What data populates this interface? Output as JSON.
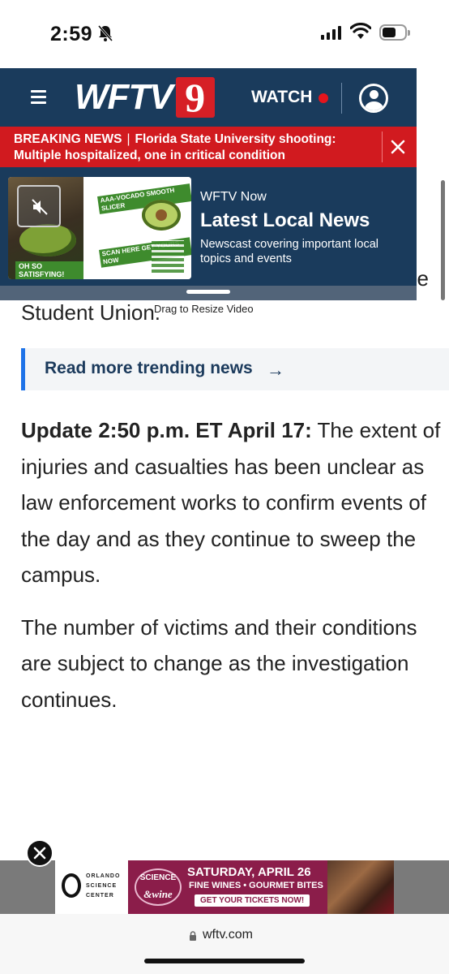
{
  "status_bar": {
    "time": "2:59"
  },
  "header": {
    "logo_text": "WFTV",
    "logo_number": "9",
    "watch_label": "WATCH"
  },
  "breaking": {
    "label": "BREAKING NEWS",
    "separator": "|",
    "headline": "Florida State University shooting: Multiple hospitalized, one in critical condition"
  },
  "video": {
    "ad_tag": "OH SO SATISFYING!",
    "ad_brand": "AAA-VOCADO SMOOTH SLICER",
    "ad_scan": "SCAN HERE GET YOURS NOW",
    "source": "WFTV Now",
    "title": "Latest Local News",
    "description": "Newscast covering important local topics and events",
    "resize_label": "Drag to Resize Video"
  },
  "article": {
    "partial_line_end": "he",
    "partial_line": "Student Union.",
    "trending_label": "Read more trending news",
    "trending_arrow": "→",
    "update_lead": "Update 2:50 p.m. ET April 17:",
    "update_body": " The extent of injuries and casualties has been unclear as law enforcement works to confirm events of the day and as they continue to sweep the campus.",
    "paragraph2": "The number of victims and their conditions are subject to change as the investigation continues."
  },
  "ad": {
    "osc_text": "ORLANDO SCIENCE CENTER",
    "science_label": "SCIENCE",
    "wine_label": "&wine",
    "line1": "SATURDAY, APRIL 26",
    "line2": "FINE WINES • GOURMET BITES",
    "cta": "GET YOUR TICKETS NOW!"
  },
  "browser": {
    "url": "wftv.com"
  },
  "colors": {
    "header_navy": "#1a3b5c",
    "breaking_red": "#d11a1f",
    "live_dot": "#e5151d",
    "accent_blue": "#1e73e8"
  }
}
